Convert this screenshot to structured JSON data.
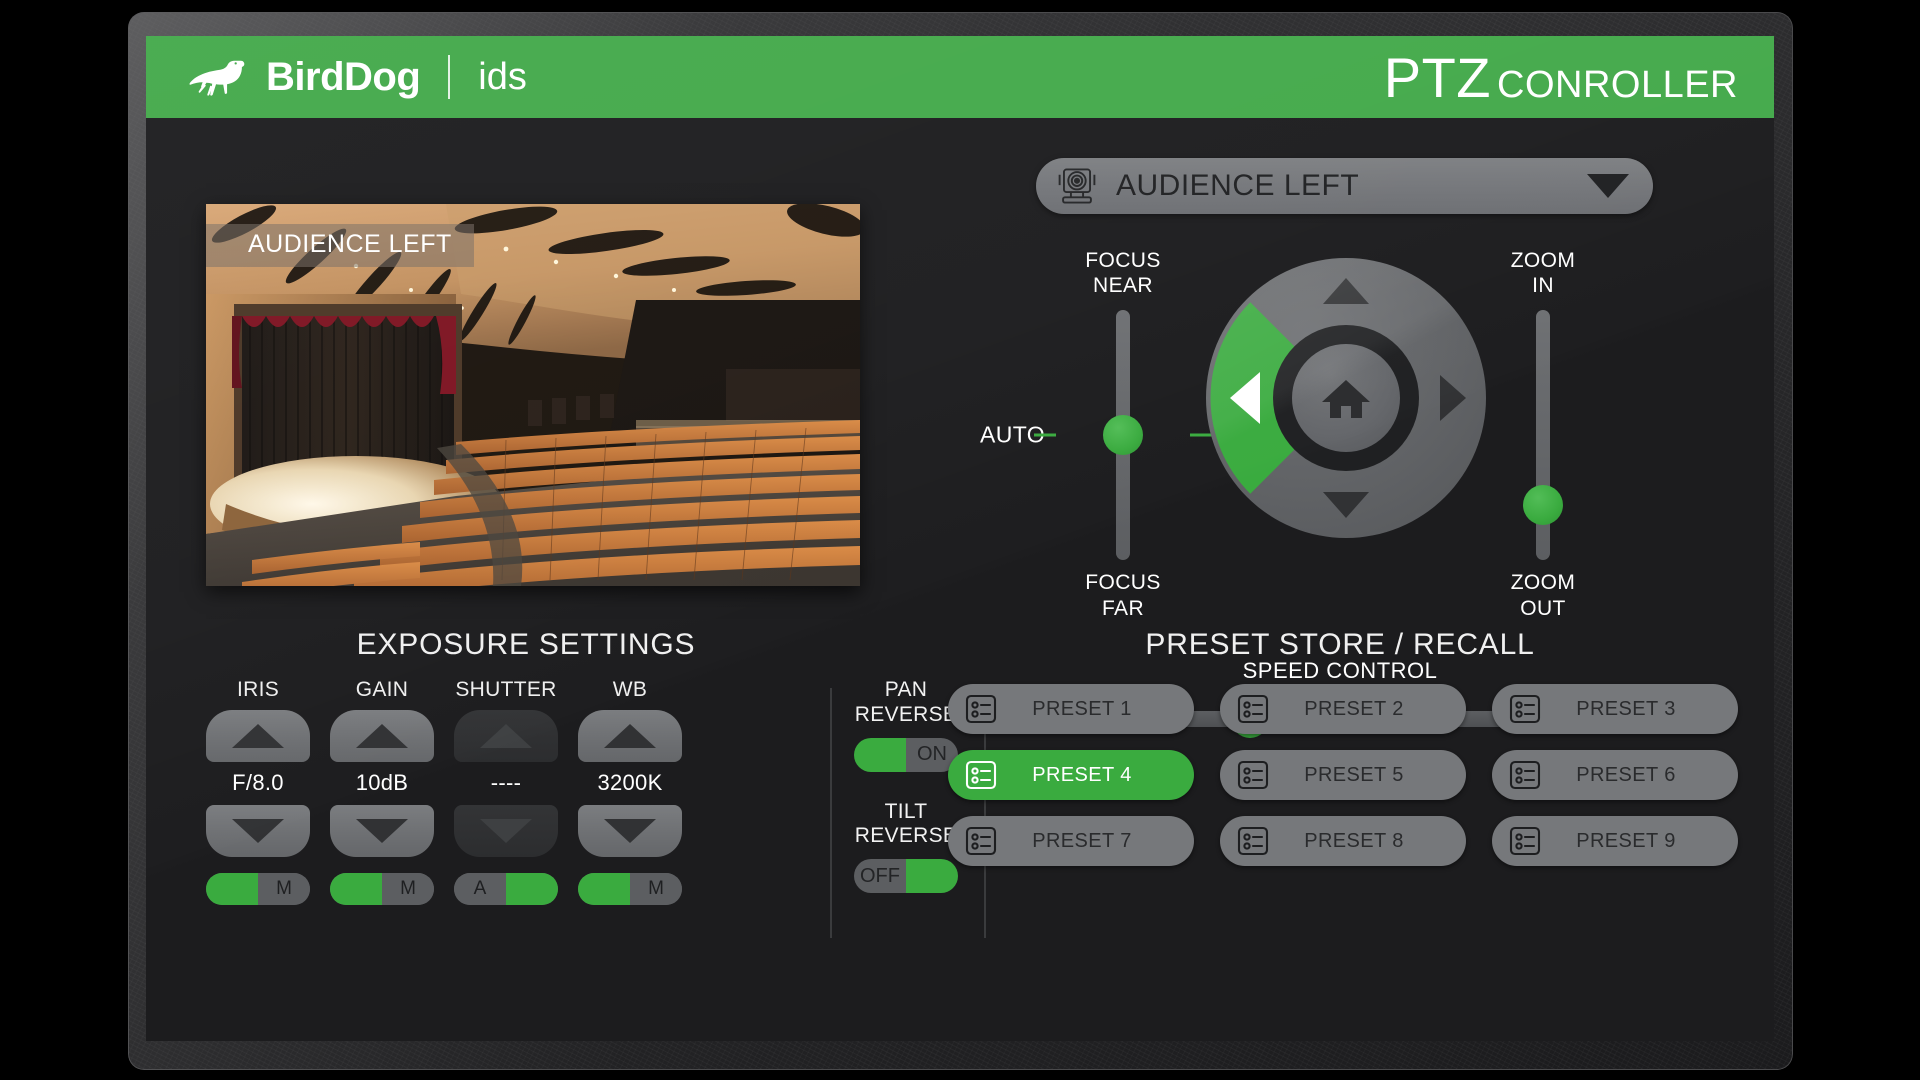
{
  "header": {
    "brand": "BirdDog",
    "product": "ids",
    "title_main": "PTZ",
    "title_sub": "CONROLLER",
    "brand_color": "#43a94a",
    "bird_icon": "bird-logo-icon"
  },
  "video": {
    "overlay_label": "AUDIENCE LEFT",
    "scene": "auditorium-stage-seats"
  },
  "camera_select": {
    "value": "AUDIENCE LEFT",
    "icon": "ptz-camera-icon",
    "caret": "chevron-down-icon"
  },
  "exposure": {
    "title": "EXPOSURE SETTINGS",
    "columns": [
      {
        "label": "IRIS",
        "value": "F/8.0",
        "disabled": false,
        "mode": "A",
        "mode_side": "left",
        "inactive_label": "M"
      },
      {
        "label": "GAIN",
        "value": "10dB",
        "disabled": false,
        "mode": "A",
        "mode_side": "left",
        "inactive_label": "M"
      },
      {
        "label": "SHUTTER",
        "value": "----",
        "disabled": true,
        "mode": "M",
        "mode_side": "right",
        "inactive_label": "A"
      },
      {
        "label": "WB",
        "value": "3200K",
        "disabled": false,
        "mode": "A",
        "mode_side": "left",
        "inactive_label": "M"
      }
    ],
    "up_icon": "arrow-up-icon",
    "down_icon": "arrow-down-icon"
  },
  "reverse": {
    "pan": {
      "label_line1": "PAN",
      "label_line2": "REVERSE",
      "state": "ON",
      "green_side": "left",
      "text_side": "right"
    },
    "tilt": {
      "label_line1": "TILT",
      "label_line2": "REVERSE",
      "state": "OFF",
      "green_side": "right",
      "text_side": "left"
    }
  },
  "ptz": {
    "focus": {
      "top_line1": "FOCUS",
      "top_line2": "NEAR",
      "bottom_line1": "FOCUS",
      "bottom_line2": "FAR",
      "auto_label": "AUTO",
      "knob_percent": 50
    },
    "zoom": {
      "top_line1": "ZOOM",
      "top_line2": "IN",
      "bottom_line1": "ZOOM",
      "bottom_line2": "OUT",
      "knob_percent": 78
    },
    "dpad": {
      "active_direction": "left",
      "up_icon": "arrow-up-icon",
      "down_icon": "arrow-down-icon",
      "left_icon": "arrow-left-icon",
      "right_icon": "arrow-right-icon",
      "home_icon": "home-icon",
      "active_color": "#3aab3f"
    },
    "speed": {
      "label": "SPEED CONTROL",
      "minus": "–",
      "plus": "+",
      "knob_percent": 30
    }
  },
  "presets": {
    "title": "PRESET STORE / RECALL",
    "active_index": 3,
    "icon": "preset-list-icon",
    "items": [
      {
        "label": "PRESET 1"
      },
      {
        "label": "PRESET 2"
      },
      {
        "label": "PRESET 3"
      },
      {
        "label": "PRESET 4"
      },
      {
        "label": "PRESET 5"
      },
      {
        "label": "PRESET 6"
      },
      {
        "label": "PRESET 7"
      },
      {
        "label": "PRESET 8"
      },
      {
        "label": "PRESET 9"
      }
    ]
  }
}
